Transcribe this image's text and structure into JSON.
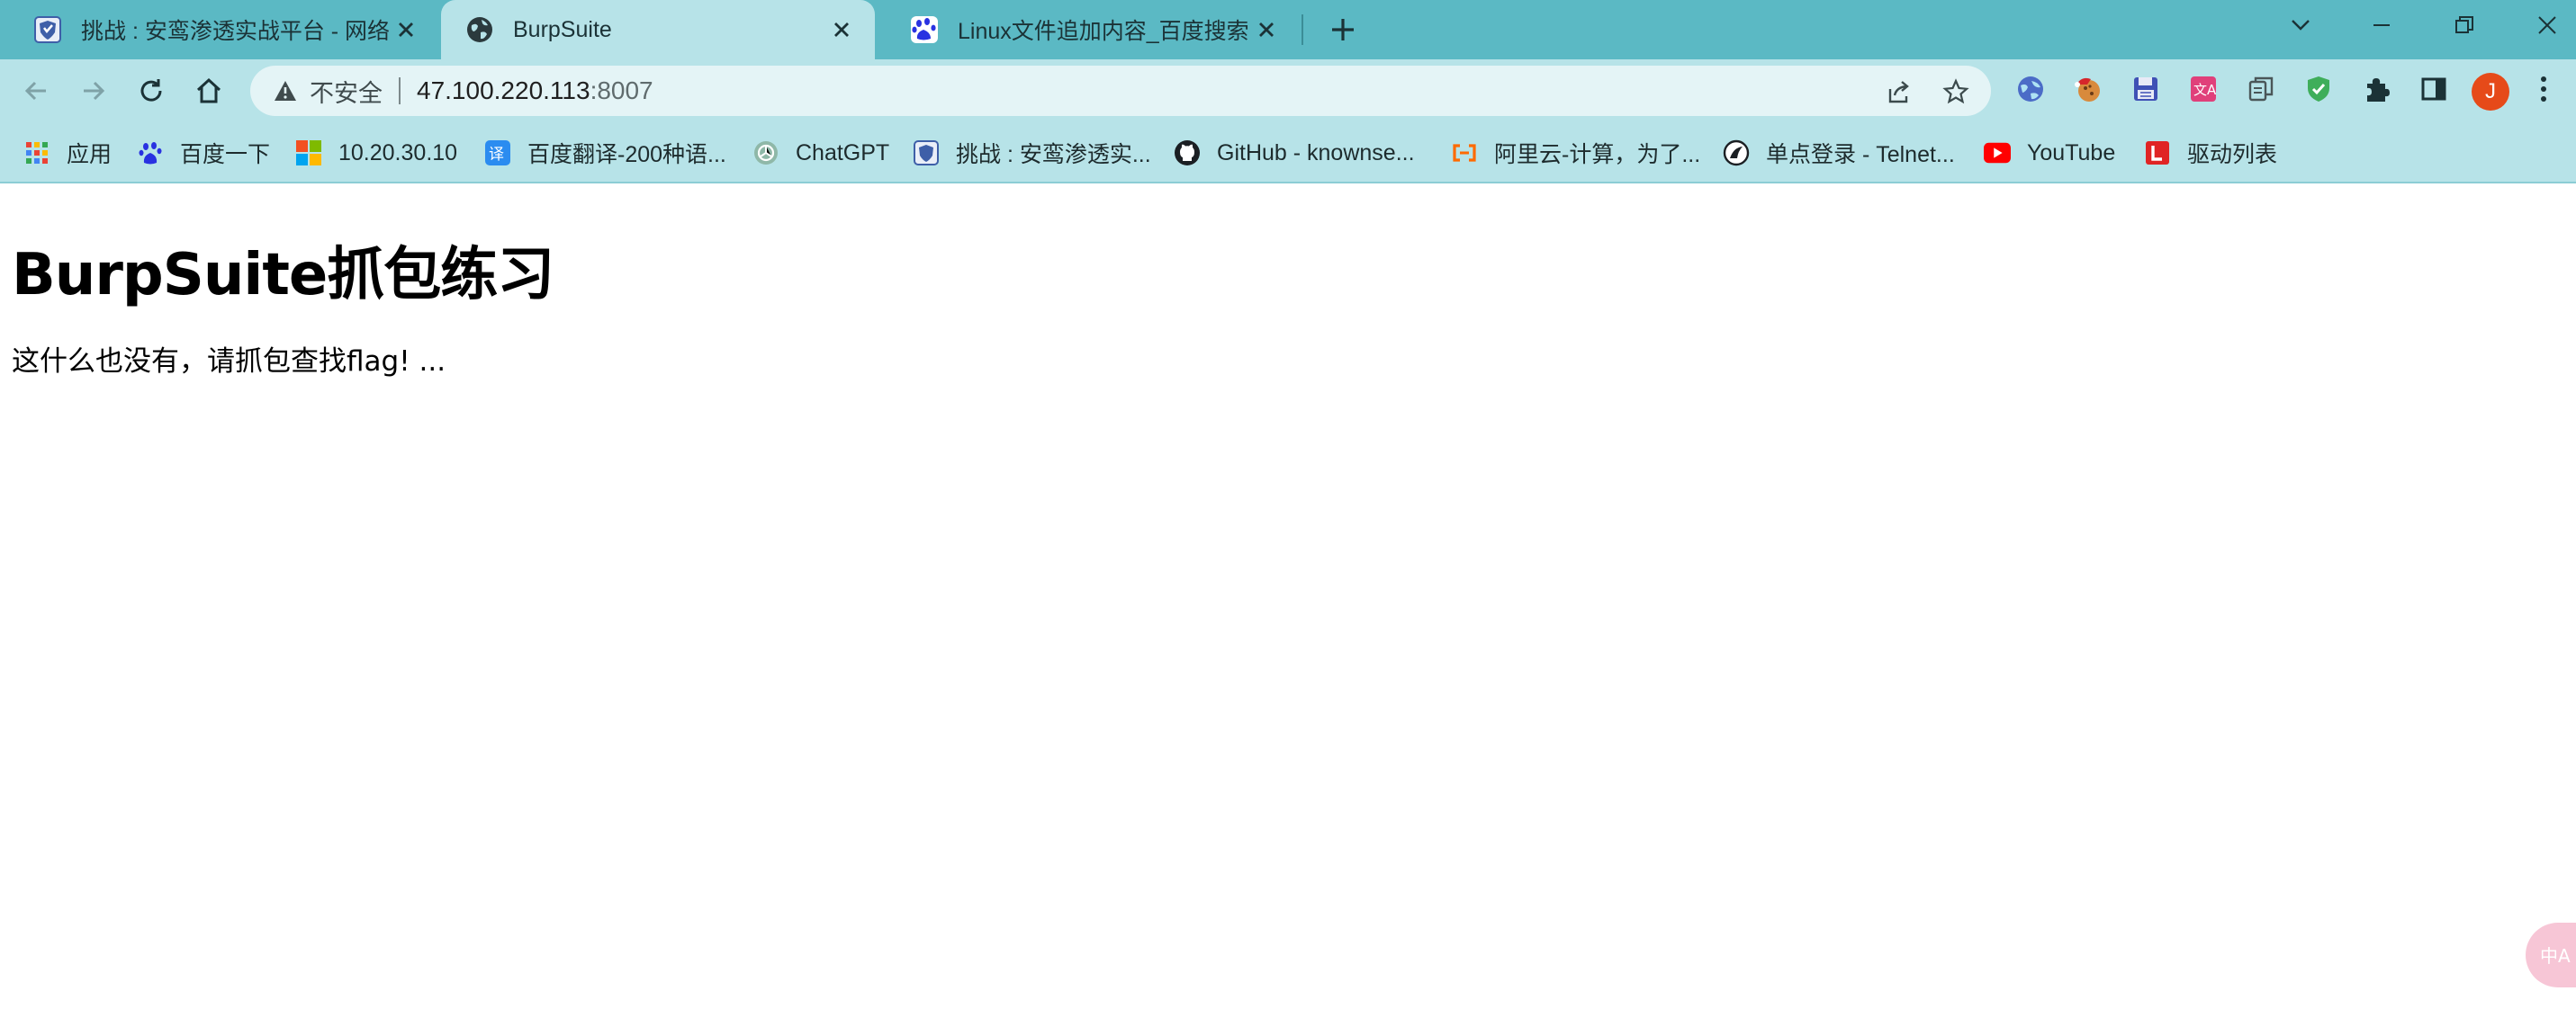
{
  "tabs": [
    {
      "title": "挑战 : 安鸾渗透实战平台 - 网络安",
      "icon": "shield-favicon",
      "active": false
    },
    {
      "title": "BurpSuite",
      "icon": "globe-favicon",
      "active": true
    },
    {
      "title": "Linux文件追加内容_百度搜索",
      "icon": "baidu-favicon",
      "active": false
    }
  ],
  "omnibox": {
    "security_label": "不安全",
    "host": "47.100.220.113",
    "port": ":8007"
  },
  "profile_initial": "J",
  "bookmarks": [
    {
      "label": "应用",
      "icon": "apps-grid-icon"
    },
    {
      "label": "百度一下",
      "icon": "baidu-icon"
    },
    {
      "label": "10.20.30.10",
      "icon": "windows-icon"
    },
    {
      "label": "百度翻译-200种语...",
      "icon": "translate-icon"
    },
    {
      "label": "ChatGPT",
      "icon": "chatgpt-icon"
    },
    {
      "label": "挑战 : 安鸾渗透实...",
      "icon": "shield-icon"
    },
    {
      "label": "GitHub - knownse...",
      "icon": "github-icon"
    },
    {
      "label": "阿里云-计算，为了...",
      "icon": "aliyun-icon"
    },
    {
      "label": "单点登录 - Telnet...",
      "icon": "telnet-icon"
    },
    {
      "label": "YouTube",
      "icon": "youtube-icon"
    },
    {
      "label": "驱动列表",
      "icon": "driver-list-icon"
    }
  ],
  "page": {
    "heading": "BurpSuite抓包练习",
    "body": "这什么也没有，请抓包查找flag! ..."
  },
  "colors": {
    "tabstrip": "#5bb9c4",
    "toolbar": "#b7e3e8",
    "omnibox": "#e4f4f6",
    "profile": "#e64a19"
  }
}
